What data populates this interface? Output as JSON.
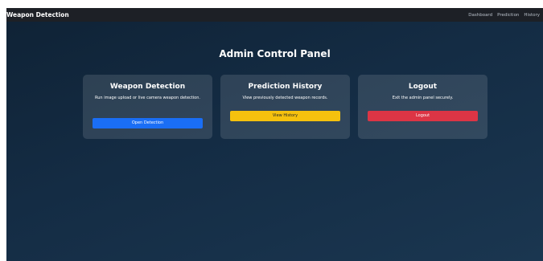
{
  "navbar": {
    "brand": "Weapon Detection",
    "links": [
      "Dashboard",
      "Prediction",
      "History"
    ]
  },
  "main": {
    "title": "Admin Control Panel"
  },
  "cards": [
    {
      "title": "Weapon Detection",
      "description": "Run image upload or live camera weapon detection.",
      "button_label": "Open Detection",
      "button_color": "#1a6ef5"
    },
    {
      "title": "Prediction History",
      "description": "View previously detected weapon records.",
      "button_label": "View History",
      "button_color": "#f5c10e"
    },
    {
      "title": "Logout",
      "description": "Exit the admin panel securely.",
      "button_label": "Logout",
      "button_color": "#dc3545"
    }
  ]
}
